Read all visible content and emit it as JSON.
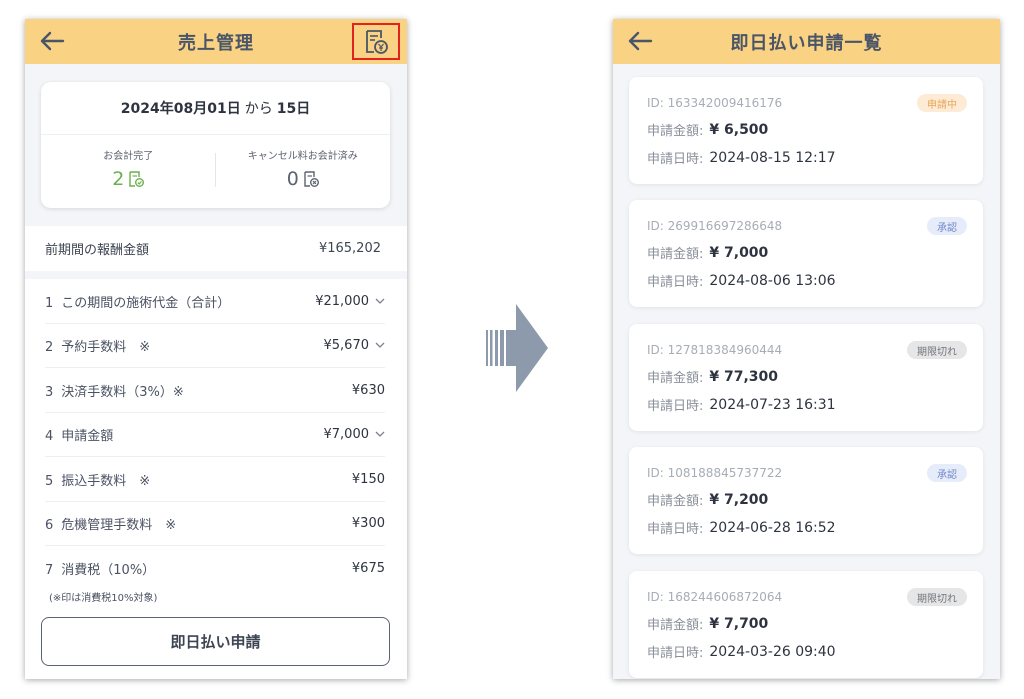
{
  "left": {
    "title": "売上管理",
    "period": {
      "start": "2024年08月01日",
      "connector": "から",
      "end": "15日"
    },
    "stats": [
      {
        "label": "お会計完了",
        "value": "2"
      },
      {
        "label": "キャンセル料お会計済み",
        "value": "0"
      }
    ],
    "previous": {
      "label": "前期間の報酬金額",
      "amount": "¥165,202"
    },
    "rows": [
      {
        "num": "1",
        "label": "この期間の施術代金（合計）",
        "amount": "¥21,000",
        "expandable": true
      },
      {
        "num": "2",
        "label": "予約手数料　※",
        "amount": "¥5,670",
        "expandable": true
      },
      {
        "num": "3",
        "label": "決済手数料（3%）※",
        "amount": "¥630",
        "expandable": false
      },
      {
        "num": "4",
        "label": "申請金額",
        "amount": "¥7,000",
        "expandable": true
      },
      {
        "num": "5",
        "label": "振込手数料　※",
        "amount": "¥150",
        "expandable": false
      },
      {
        "num": "6",
        "label": "危機管理手数料　※",
        "amount": "¥300",
        "expandable": false
      },
      {
        "num": "7",
        "label": "消費税（10%）",
        "amount": "¥675",
        "expandable": false
      }
    ],
    "note": "(※印は消費税10%対象)",
    "apply_button": "即日払い申請"
  },
  "right": {
    "title": "即日払い申請一覧",
    "amount_label": "申請金額:",
    "date_label": "申請日時:",
    "requests": [
      {
        "id": "ID: 163342009416176",
        "amount": "¥ 6,500",
        "date": "2024-08-15 12:17",
        "status": "申請中",
        "status_type": "pending"
      },
      {
        "id": "ID: 269916697286648",
        "amount": "¥ 7,000",
        "date": "2024-08-06 13:06",
        "status": "承認",
        "status_type": "approved"
      },
      {
        "id": "ID: 127818384960444",
        "amount": "¥ 77,300",
        "date": "2024-07-23 16:31",
        "status": "期限切れ",
        "status_type": "expired"
      },
      {
        "id": "ID: 108188845737722",
        "amount": "¥ 7,200",
        "date": "2024-06-28 16:52",
        "status": "承認",
        "status_type": "approved"
      },
      {
        "id": "ID: 168244606872064",
        "amount": "¥ 7,700",
        "date": "2024-03-26 09:40",
        "status": "期限切れ",
        "status_type": "expired"
      }
    ]
  },
  "colors": {
    "header": "#f9d283",
    "pending_bg": "#fdebd5",
    "pending_fg": "#e9a55a",
    "approved_bg": "#e6ecfa",
    "approved_fg": "#6f88c9",
    "expired_bg": "#e6e6e6",
    "expired_fg": "#6f747c",
    "highlight": "#e0231c",
    "arrow": "#8c9aab"
  },
  "icons": {
    "back": "arrow-left-icon",
    "receipt": "receipt-yen-icon",
    "completed": "receipt-check-icon",
    "cancelled": "receipt-x-icon",
    "expand": "chevron-down-icon",
    "transition": "arrow-right-icon"
  }
}
